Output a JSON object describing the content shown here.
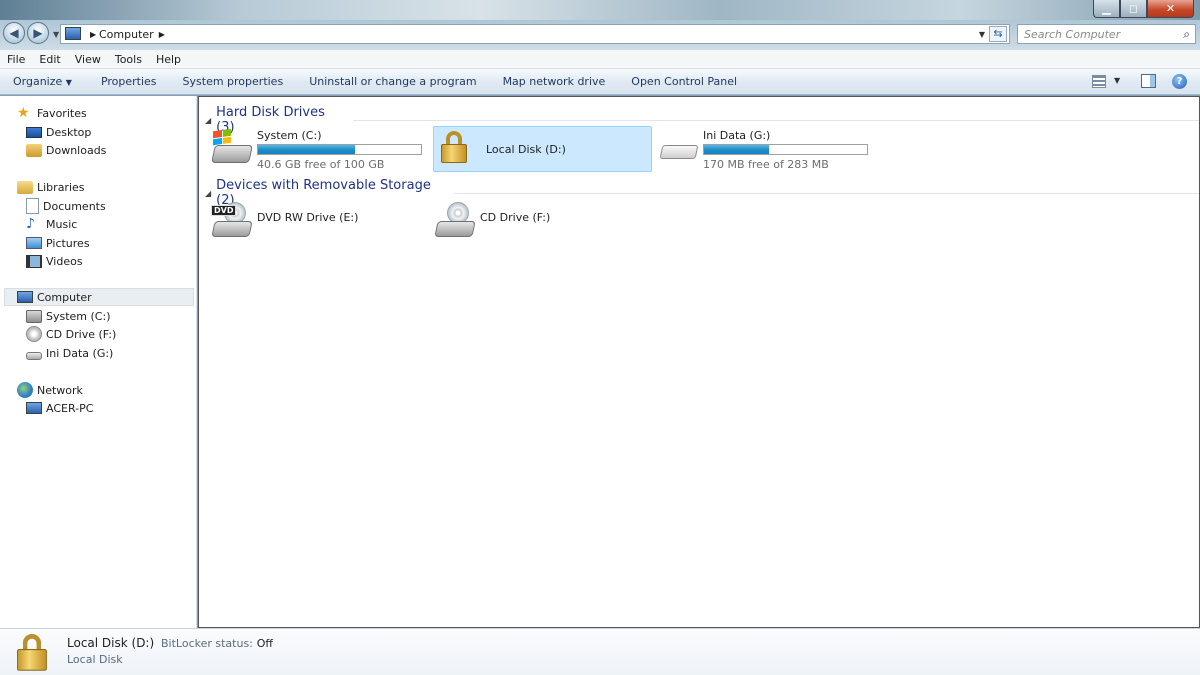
{
  "window": {
    "controls": {
      "minimize_icon": "minimize-icon",
      "maximize_icon": "maximize-icon",
      "close_icon": "close-icon"
    }
  },
  "address_bar": {
    "crumb": "Computer"
  },
  "search": {
    "placeholder": "Search Computer"
  },
  "menu": [
    "File",
    "Edit",
    "View",
    "Tools",
    "Help"
  ],
  "commands": {
    "organize": "Organize",
    "properties": "Properties",
    "system_properties": "System properties",
    "uninstall": "Uninstall or change a program",
    "map_drive": "Map network drive",
    "control_panel": "Open Control Panel"
  },
  "sidebar": {
    "favorites": {
      "label": "Favorites",
      "items": [
        "Desktop",
        "Downloads"
      ]
    },
    "libraries": {
      "label": "Libraries",
      "items": [
        "Documents",
        "Music",
        "Pictures",
        "Videos"
      ]
    },
    "computer": {
      "label": "Computer",
      "items": [
        "System (C:)",
        "CD Drive (F:)",
        "Ini Data (G:)"
      ]
    },
    "network": {
      "label": "Network",
      "items": [
        "ACER-PC"
      ]
    }
  },
  "groups": {
    "hdd": {
      "title": "Hard Disk Drives (3)",
      "drives": [
        {
          "name": "System (C:)",
          "free": "40.6 GB free of 100 GB",
          "used_fraction": 0.594
        },
        {
          "name": "Local Disk (D:)"
        },
        {
          "name": "Ini Data (G:)",
          "free": "170 MB free of 283 MB",
          "used_fraction": 0.4
        }
      ]
    },
    "removable": {
      "title": "Devices with Removable Storage (2)",
      "drives": [
        {
          "name": "DVD RW Drive (E:)",
          "badge": "DVD"
        },
        {
          "name": "CD Drive (F:)"
        }
      ]
    }
  },
  "details": {
    "name": "Local Disk (D:)",
    "bitlocker_label": "BitLocker status:",
    "bitlocker_value": "Off",
    "type": "Local Disk"
  },
  "colors": {
    "accent": "#1e3287",
    "selection": "#cce8ff",
    "bar_fill": "#1f8fc8",
    "close_button": "#c74a2c"
  }
}
